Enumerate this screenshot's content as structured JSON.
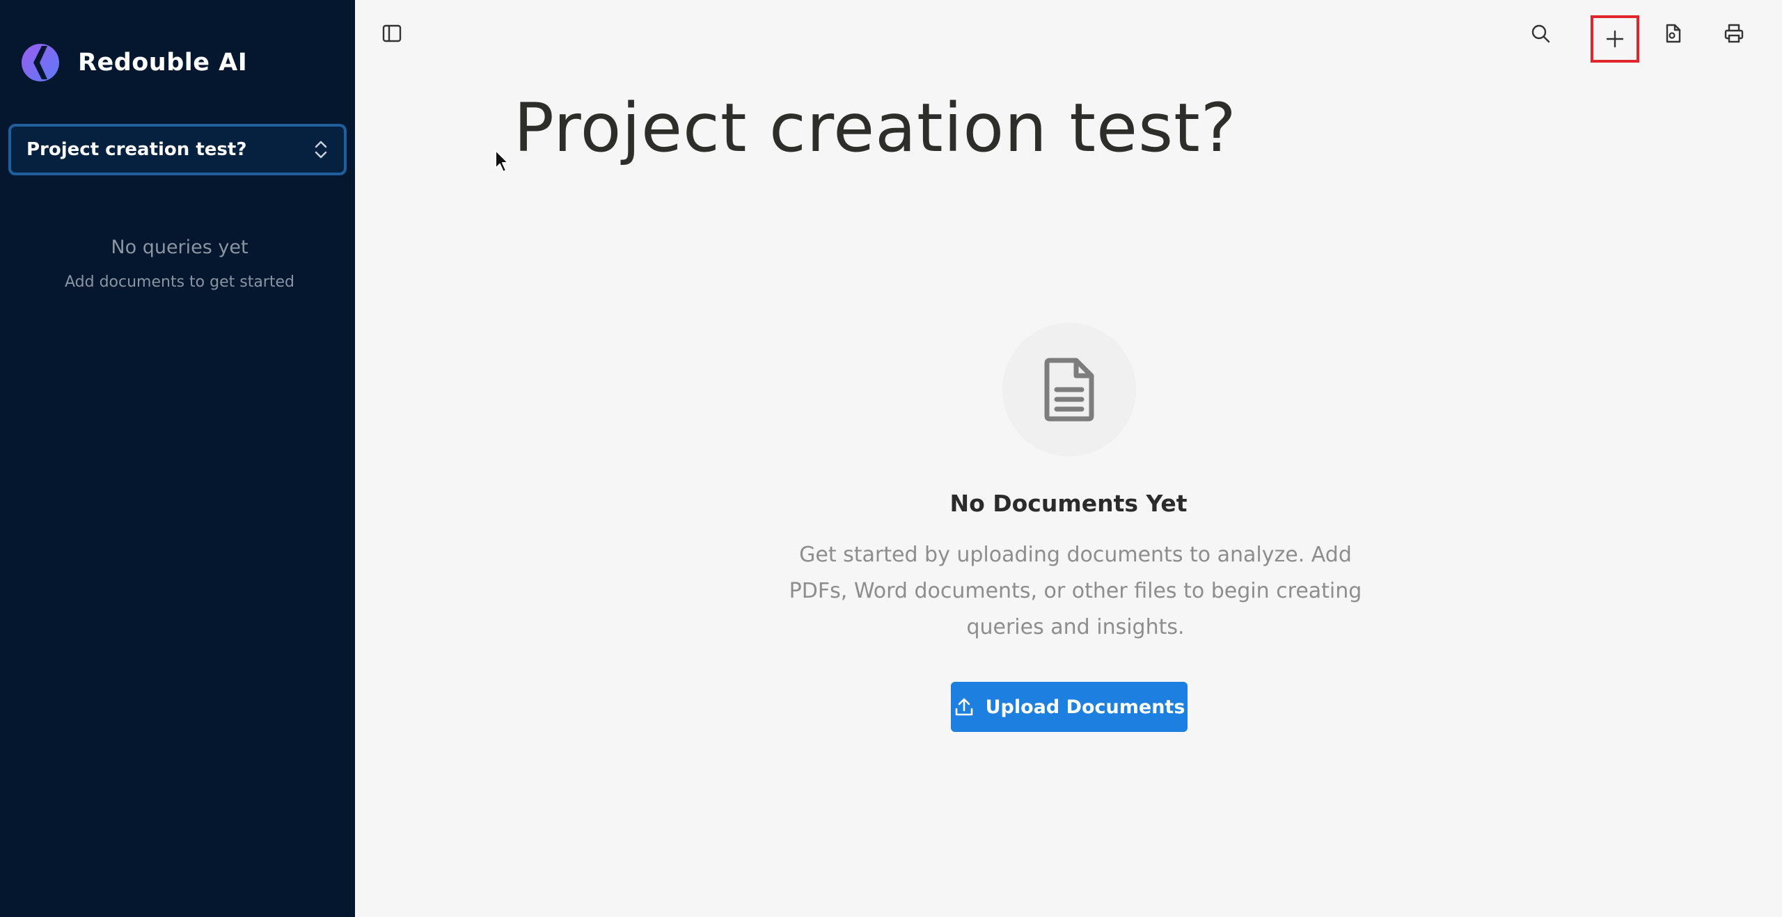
{
  "sidebar": {
    "brand_name": "Redouble AI",
    "project_selector": {
      "value": "Project creation test?"
    },
    "empty_state": {
      "title": "No queries yet",
      "subtitle": "Add documents to get started"
    }
  },
  "toolbar": {
    "icons": [
      "sidebar-toggle-icon",
      "search-icon",
      "plus-icon",
      "file-settings-icon",
      "printer-icon"
    ]
  },
  "main": {
    "title": "Project creation test?",
    "empty_state": {
      "icon": "document-icon",
      "title": "No Documents Yet",
      "description": "Get started by uploading documents to analyze. Add PDFs, Word documents, or other files to begin creating queries and insights.",
      "button_label": "Upload Documents"
    }
  },
  "colors": {
    "sidebar_bg": "#04172f",
    "primary_button": "#1d80e0",
    "highlight_border": "#e0262b"
  }
}
